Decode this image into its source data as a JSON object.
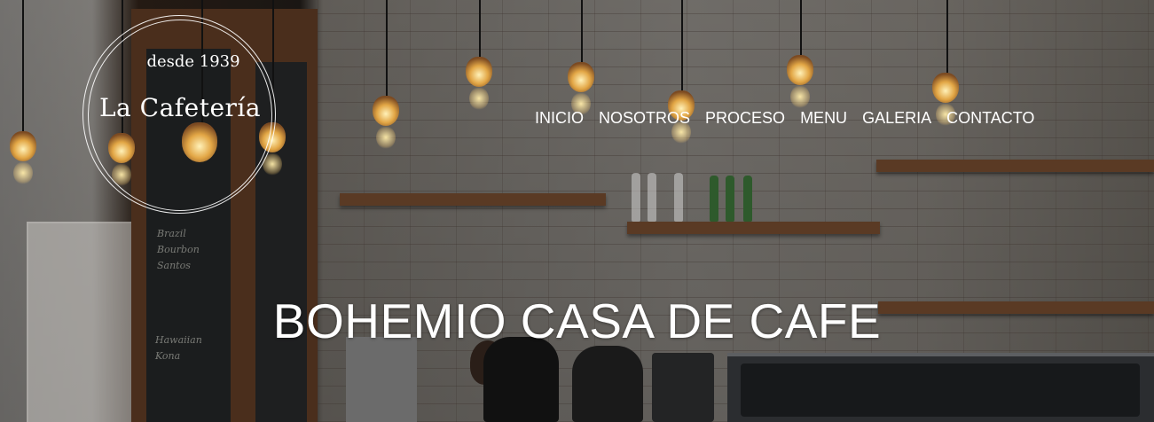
{
  "brand": {
    "since": "desde 1939",
    "name": "La Cafetería"
  },
  "nav": {
    "items": [
      {
        "label": "INICIO"
      },
      {
        "label": "NOSOTROS"
      },
      {
        "label": "PROCESO"
      },
      {
        "label": "MENU"
      },
      {
        "label": "GALERIA"
      },
      {
        "label": "CONTACTO"
      }
    ]
  },
  "hero": {
    "title": "BOHEMIO CASA DE CAFE"
  },
  "colors": {
    "nav_text": "#ffffff",
    "title_text": "#ffffff",
    "overlay": "#000000"
  }
}
